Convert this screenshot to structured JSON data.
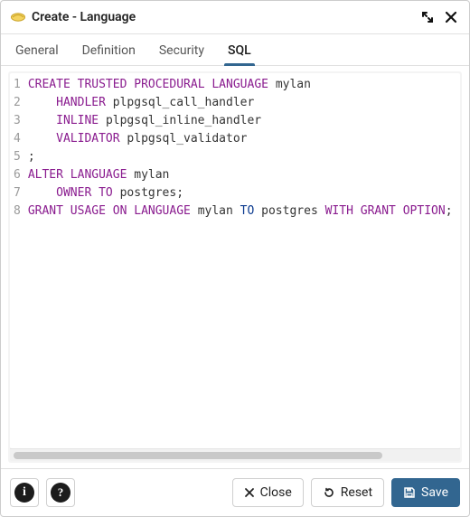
{
  "window": {
    "title": "Create - Language"
  },
  "tabs": [
    {
      "label": "General",
      "active": false
    },
    {
      "label": "Definition",
      "active": false
    },
    {
      "label": "Security",
      "active": false
    },
    {
      "label": "SQL",
      "active": true
    }
  ],
  "code": {
    "lines": [
      {
        "n": 1,
        "tokens": [
          {
            "t": "CREATE",
            "c": "kw"
          },
          {
            "t": " "
          },
          {
            "t": "TRUSTED",
            "c": "kw"
          },
          {
            "t": " "
          },
          {
            "t": "PROCEDURAL",
            "c": "kw"
          },
          {
            "t": " "
          },
          {
            "t": "LANGUAGE",
            "c": "kw"
          },
          {
            "t": " "
          },
          {
            "t": "mylan",
            "c": "ident"
          }
        ]
      },
      {
        "n": 2,
        "tokens": [
          {
            "t": "    "
          },
          {
            "t": "HANDLER",
            "c": "kw"
          },
          {
            "t": " "
          },
          {
            "t": "plpgsql_call_handler",
            "c": "ident"
          }
        ]
      },
      {
        "n": 3,
        "tokens": [
          {
            "t": "    "
          },
          {
            "t": "INLINE",
            "c": "kw"
          },
          {
            "t": " "
          },
          {
            "t": "plpgsql_inline_handler",
            "c": "ident"
          }
        ]
      },
      {
        "n": 4,
        "tokens": [
          {
            "t": "    "
          },
          {
            "t": "VALIDATOR",
            "c": "kw"
          },
          {
            "t": " "
          },
          {
            "t": "plpgsql_validator",
            "c": "ident"
          }
        ]
      },
      {
        "n": 5,
        "tokens": [
          {
            "t": ";",
            "c": "punc"
          }
        ]
      },
      {
        "n": 6,
        "tokens": [
          {
            "t": "ALTER",
            "c": "kw"
          },
          {
            "t": " "
          },
          {
            "t": "LANGUAGE",
            "c": "kw"
          },
          {
            "t": " "
          },
          {
            "t": "mylan",
            "c": "ident"
          }
        ]
      },
      {
        "n": 7,
        "tokens": [
          {
            "t": "    "
          },
          {
            "t": "OWNER TO",
            "c": "kw"
          },
          {
            "t": " "
          },
          {
            "t": "postgres",
            "c": "ident"
          },
          {
            "t": ";",
            "c": "punc"
          }
        ]
      },
      {
        "n": 8,
        "tokens": [
          {
            "t": "GRANT",
            "c": "kw"
          },
          {
            "t": " "
          },
          {
            "t": "USAGE",
            "c": "kw"
          },
          {
            "t": " "
          },
          {
            "t": "ON",
            "c": "kw"
          },
          {
            "t": " "
          },
          {
            "t": "LANGUAGE",
            "c": "kw"
          },
          {
            "t": " "
          },
          {
            "t": "mylan",
            "c": "ident"
          },
          {
            "t": " "
          },
          {
            "t": "TO",
            "c": "to"
          },
          {
            "t": " "
          },
          {
            "t": "postgres",
            "c": "ident"
          },
          {
            "t": " "
          },
          {
            "t": "WITH",
            "c": "kw"
          },
          {
            "t": " "
          },
          {
            "t": "GRANT",
            "c": "kw"
          },
          {
            "t": " "
          },
          {
            "t": "OPTION",
            "c": "kw"
          },
          {
            "t": ";",
            "c": "punc"
          }
        ]
      }
    ]
  },
  "footer": {
    "close": "Close",
    "reset": "Reset",
    "save": "Save"
  },
  "colors": {
    "accent": "#326690",
    "keyword": "#8a1c8f"
  }
}
